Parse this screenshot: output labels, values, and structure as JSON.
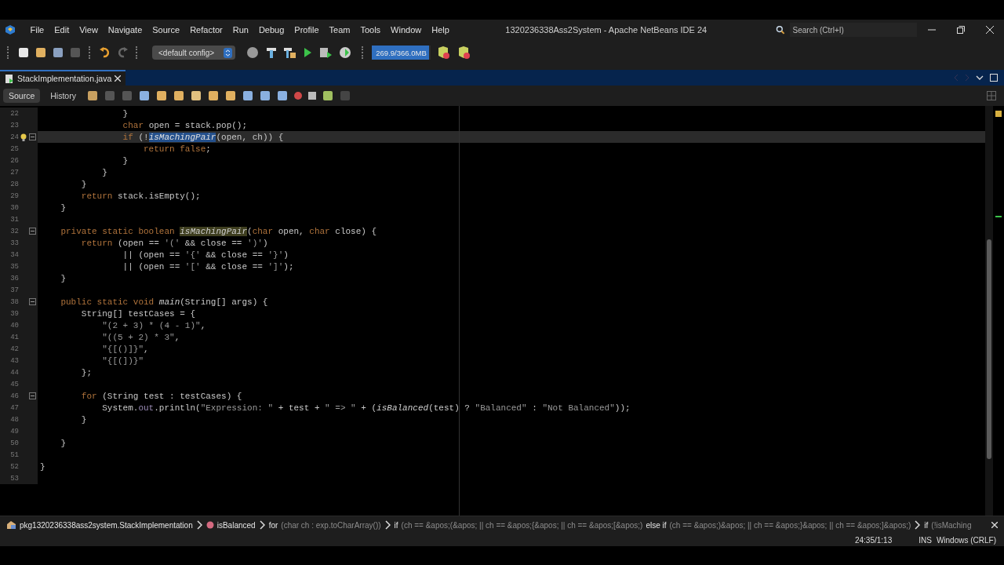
{
  "window": {
    "title": "1320236338Ass2System - Apache NetBeans IDE 24",
    "search": {
      "placeholder": "Search (Ctrl+I)"
    }
  },
  "menu": [
    "File",
    "Edit",
    "View",
    "Navigate",
    "Source",
    "Refactor",
    "Run",
    "Debug",
    "Profile",
    "Team",
    "Tools",
    "Window",
    "Help"
  ],
  "toolbar": {
    "config": "<default config>",
    "memory": {
      "reading": "269.9/366.0MB",
      "level": 0.97
    }
  },
  "tabs": [
    {
      "label": "StackImplementation.java",
      "selected": true
    }
  ],
  "editor_tabs": [
    {
      "label": "Source",
      "selected": true
    },
    {
      "label": "History",
      "selected": false
    }
  ],
  "lines": [
    {
      "number": "22",
      "segments": [
        {
          "kind": "plain",
          "text": "                }"
        }
      ]
    },
    {
      "number": "23",
      "segments": [
        {
          "kind": "keyword",
          "text": "                char"
        },
        {
          "kind": "plain",
          "text": " open = stack.pop();"
        }
      ]
    },
    {
      "number": "24",
      "current": true,
      "hint": true,
      "fold": true,
      "segments": [
        {
          "kind": "keyword",
          "text": "                if"
        },
        {
          "kind": "plain",
          "text": " (!"
        },
        {
          "kind": "selected",
          "text": "isMachingPair"
        },
        {
          "kind": "plain",
          "text": "(open, ch)) {"
        }
      ]
    },
    {
      "number": "25",
      "segments": [
        {
          "kind": "keyword",
          "text": "                    return false"
        },
        {
          "kind": "plain",
          "text": ";"
        }
      ]
    },
    {
      "number": "26",
      "segments": [
        {
          "kind": "plain",
          "text": "                }"
        }
      ]
    },
    {
      "number": "27",
      "segments": [
        {
          "kind": "plain",
          "text": "            }"
        }
      ]
    },
    {
      "number": "28",
      "segments": [
        {
          "kind": "plain",
          "text": "        }"
        }
      ]
    },
    {
      "number": "29",
      "segments": [
        {
          "kind": "keyword",
          "text": "        return"
        },
        {
          "kind": "plain",
          "text": " stack.isEmpty();"
        }
      ]
    },
    {
      "number": "30",
      "segments": [
        {
          "kind": "plain",
          "text": "    }"
        }
      ]
    },
    {
      "number": "31"
    },
    {
      "number": "32",
      "fold": true,
      "segments": [
        {
          "kind": "keyword",
          "text": "    private static boolean "
        },
        {
          "kind": "occurrence",
          "text": "isMachingPair"
        },
        {
          "kind": "plain",
          "text": "("
        },
        {
          "kind": "keyword",
          "text": "char"
        },
        {
          "kind": "plain",
          "text": " open, "
        },
        {
          "kind": "keyword",
          "text": "char"
        },
        {
          "kind": "plain",
          "text": " close) {"
        }
      ]
    },
    {
      "number": "33",
      "segments": [
        {
          "kind": "keyword",
          "text": "        return"
        },
        {
          "kind": "plain",
          "text": " (open == "
        },
        {
          "kind": "string",
          "text": "'('"
        },
        {
          "kind": "plain",
          "text": " && close == "
        },
        {
          "kind": "string",
          "text": "')'"
        },
        {
          "kind": "plain",
          "text": ")"
        }
      ]
    },
    {
      "number": "34",
      "segments": [
        {
          "kind": "plain",
          "text": "                || (open == "
        },
        {
          "kind": "string",
          "text": "'{'"
        },
        {
          "kind": "plain",
          "text": " && close == "
        },
        {
          "kind": "string",
          "text": "'}'"
        },
        {
          "kind": "plain",
          "text": ")"
        }
      ]
    },
    {
      "number": "35",
      "segments": [
        {
          "kind": "plain",
          "text": "                || (open == "
        },
        {
          "kind": "string",
          "text": "'['"
        },
        {
          "kind": "plain",
          "text": " && close == "
        },
        {
          "kind": "string",
          "text": "']'"
        },
        {
          "kind": "plain",
          "text": ");"
        }
      ]
    },
    {
      "number": "36",
      "segments": [
        {
          "kind": "plain",
          "text": "    }"
        }
      ]
    },
    {
      "number": "37"
    },
    {
      "number": "38",
      "fold": true,
      "segments": [
        {
          "kind": "keyword",
          "text": "    public static void "
        },
        {
          "kind": "static",
          "text": "main"
        },
        {
          "kind": "plain",
          "text": "(String[] args) {"
        }
      ]
    },
    {
      "number": "39",
      "segments": [
        {
          "kind": "plain",
          "text": "        String[] testCases = {"
        }
      ]
    },
    {
      "number": "40",
      "segments": [
        {
          "kind": "string",
          "text": "            \"(2 + 3) * (4 - 1)\""
        },
        {
          "kind": "plain",
          "text": ","
        }
      ]
    },
    {
      "number": "41",
      "segments": [
        {
          "kind": "string",
          "text": "            \"((5 + 2) * 3\""
        },
        {
          "kind": "plain",
          "text": ","
        }
      ]
    },
    {
      "number": "42",
      "segments": [
        {
          "kind": "string",
          "text": "            \"{[()]}\""
        },
        {
          "kind": "plain",
          "text": ","
        }
      ]
    },
    {
      "number": "43",
      "segments": [
        {
          "kind": "string",
          "text": "            \"{[(])}\""
        }
      ]
    },
    {
      "number": "44",
      "segments": [
        {
          "kind": "plain",
          "text": "        };"
        }
      ]
    },
    {
      "number": "45"
    },
    {
      "number": "46",
      "fold": true,
      "segments": [
        {
          "kind": "keyword",
          "text": "        for"
        },
        {
          "kind": "plain",
          "text": " (String test : testCases) {"
        }
      ]
    },
    {
      "number": "47",
      "segments": [
        {
          "kind": "plain",
          "text": "            System."
        },
        {
          "kind": "field",
          "text": "out"
        },
        {
          "kind": "plain",
          "text": ".println("
        },
        {
          "kind": "string",
          "text": "\"Expression: \""
        },
        {
          "kind": "plain",
          "text": " + test + "
        },
        {
          "kind": "string",
          "text": "\" => \""
        },
        {
          "kind": "plain",
          "text": " + ("
        },
        {
          "kind": "static",
          "text": "isBalanced"
        },
        {
          "kind": "plain",
          "text": "(test) ? "
        },
        {
          "kind": "string",
          "text": "\"Balanced\""
        },
        {
          "kind": "plain",
          "text": " : "
        },
        {
          "kind": "string",
          "text": "\"Not Balanced\""
        },
        {
          "kind": "plain",
          "text": "));"
        }
      ]
    },
    {
      "number": "48",
      "segments": [
        {
          "kind": "plain",
          "text": "        }"
        }
      ]
    },
    {
      "number": "49"
    },
    {
      "number": "50",
      "segments": [
        {
          "kind": "plain",
          "text": "    }"
        }
      ]
    },
    {
      "number": "51"
    },
    {
      "number": "52",
      "segments": [
        {
          "kind": "plain",
          "text": "}"
        }
      ]
    },
    {
      "number": "53"
    }
  ],
  "breadcrumbs": [
    {
      "kind": "package",
      "segments": [
        {
          "kind": "name",
          "text": "pkg1320236338ass2system.StackImplementation"
        }
      ]
    },
    {
      "kind": "method",
      "segments": [
        {
          "kind": "name",
          "text": "isBalanced"
        }
      ]
    },
    {
      "kind": "statement",
      "segments": [
        {
          "kind": "name",
          "text": "for"
        },
        {
          "kind": "detail",
          "text": "(char ch : exp.toCharArray())"
        }
      ]
    },
    {
      "kind": "statement",
      "segments": [
        {
          "kind": "name",
          "text": "if"
        },
        {
          "kind": "detail",
          "text": "(ch == &apos;(&apos; || ch == &apos;{&apos; || ch == &apos;[&apos;)"
        },
        {
          "kind": "name",
          "text": "else if"
        },
        {
          "kind": "detail",
          "text": "(ch == &apos;)&apos; || ch == &apos;}&apos; || ch == &apos;]&apos;)"
        }
      ]
    },
    {
      "kind": "statement",
      "segments": [
        {
          "kind": "name",
          "text": "if"
        },
        {
          "kind": "detail",
          "text": "(!isMaching"
        }
      ]
    }
  ],
  "status_bar": {
    "position": "24:35/1:13",
    "mode": "INS",
    "line_endings": "Windows (CRLF)"
  }
}
